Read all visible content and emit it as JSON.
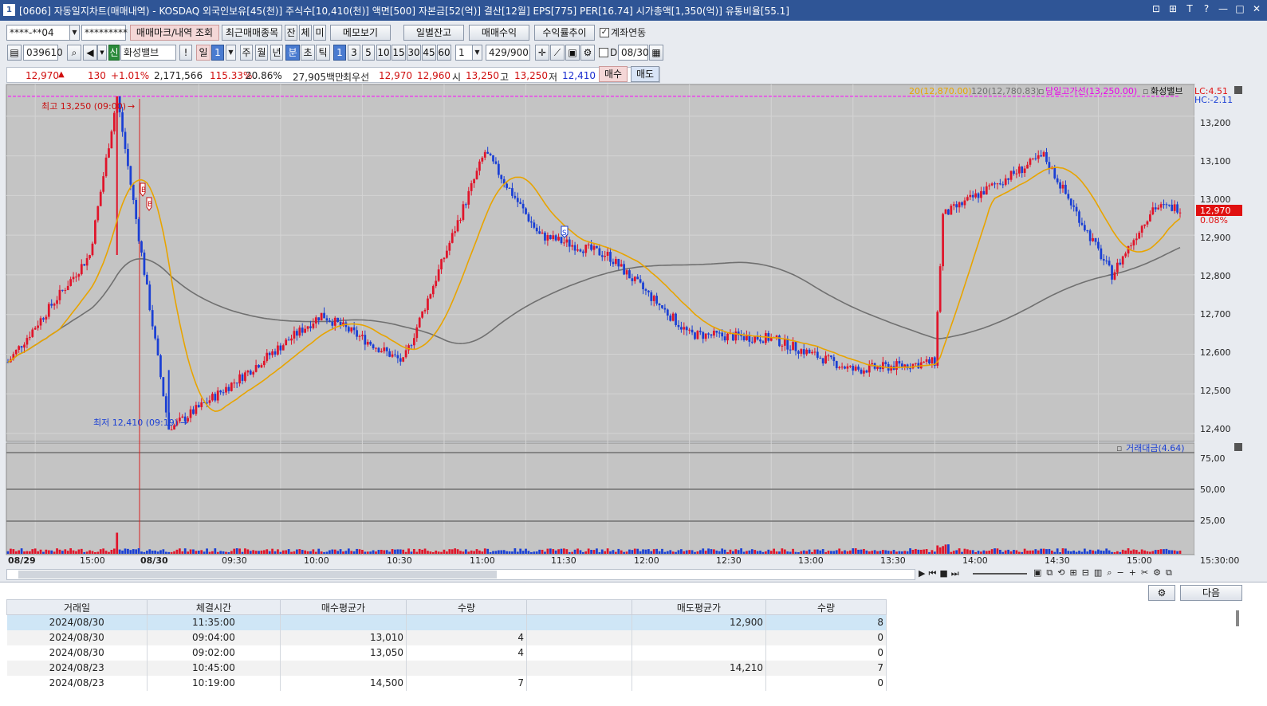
{
  "window": {
    "title": "[0606] 자동일지차트(매매내역) - KOSDAQ 외국인보유[45(천)] 주식수[10,410(천)] 액면[500] 자본금[52(억)] 결산[12월] EPS[775] PER[16.74] 시가총액[1,350(억)] 유통비율[55.1]",
    "icon": "1",
    "buttons": [
      "⊡",
      "⊞",
      "T",
      "?",
      "—",
      "□",
      "✕"
    ]
  },
  "toolbar1": {
    "account": "****-**04",
    "password": "*********",
    "trade_mark_btn": "매매마크/내역 조회",
    "recent_items_btn": "최근매매종목",
    "tab_jan": "잔",
    "tab_che": "체",
    "tab_mi": "미",
    "memo_btn": "메모보기",
    "daily_balance_btn": "일별잔고",
    "trade_profit_btn": "매매수익",
    "return_trend_btn": "수익률추이",
    "account_link_label": "계좌연동"
  },
  "toolbar2": {
    "code": "039610",
    "badge": "신",
    "stock_name": "화성밸브",
    "exclaim": "!",
    "period_day": "일",
    "period_num": "1",
    "periods": [
      "주",
      "월",
      "년",
      "분",
      "초",
      "틱"
    ],
    "active_period": "분",
    "intervals": [
      "1",
      "3",
      "5",
      "10",
      "15",
      "30",
      "45",
      "60"
    ],
    "active_interval": "1",
    "custom_interval": "1",
    "count": "429",
    "count_total": "/900",
    "d_label": "D",
    "date": "08/30"
  },
  "quote": {
    "price": "12,970",
    "arrow": "▲",
    "change": "130",
    "change_pct": "+1.01%",
    "volume": "2,171,566",
    "vol_ratio": "115.33%",
    "turnover": "20.86%",
    "amount": "27,905백만",
    "best_label": "최우선",
    "best_sell": "12,970",
    "best_buy": "12,960",
    "open_label": "시",
    "open": "13,250",
    "high_label": "고",
    "high": "13,250",
    "low_label": "저",
    "low": "12,410",
    "buy_btn": "매수",
    "sell_btn": "매도"
  },
  "chart": {
    "legend_ma20": "20(12,870.00)",
    "legend_ma120": "120(12,780.83)",
    "legend_high_line": "당일고가선(13,250.00)",
    "legend_stock": "화성밸브",
    "lc": "LC:4.51",
    "hc": "HC:-2.11",
    "price_ticks": [
      "13,200",
      "13,100",
      "13,000",
      "12,900",
      "12,800",
      "12,700",
      "12,600",
      "12,500",
      "12,400"
    ],
    "current_price": "12,970",
    "current_pct": "0.08%",
    "high_marker": "최고 13,250 (09:00)",
    "low_marker": "최저 12,410 (09:19)",
    "buy_mark": "B",
    "sell_mark": "S",
    "volume_legend": "거래대금(4.64)",
    "volume_ticks": [
      "75,00",
      "50,00",
      "25,00"
    ],
    "time_labels": [
      "08/29",
      "15:00",
      "08/30",
      "09:30",
      "10:00",
      "10:30",
      "11:00",
      "11:30",
      "12:00",
      "12:30",
      "13:00",
      "13:30",
      "14:00",
      "14:30",
      "15:00",
      "15:30:00"
    ],
    "colors": {
      "up": "#e0142a",
      "down": "#1a3fd4",
      "ma20": "#e8a400",
      "ma120": "#707070",
      "highline": "#ff00ff",
      "bg": "#c4c4c4"
    }
  },
  "chart_data": {
    "type": "candlestick",
    "title": "화성밸브 1분봉",
    "ylim": [
      12380,
      13280
    ],
    "x_range": [
      "08/29 14:50",
      "08/30 15:30"
    ],
    "key_points": [
      {
        "time": "08/29 14:50",
        "price": 12580
      },
      {
        "time": "08/29 15:20",
        "price": 12850
      },
      {
        "time": "08/30 09:00",
        "price": 13250
      },
      {
        "time": "08/30 09:19",
        "price": 12410
      },
      {
        "time": "08/30 09:45",
        "price": 12540
      },
      {
        "time": "08/30 10:15",
        "price": 12700
      },
      {
        "time": "08/30 10:45",
        "price": 12580
      },
      {
        "time": "08/30 11:15",
        "price": 13110
      },
      {
        "time": "08/30 11:35",
        "price": 12900
      },
      {
        "time": "08/30 12:00",
        "price": 12850
      },
      {
        "time": "08/30 12:30",
        "price": 12650
      },
      {
        "time": "08/30 13:00",
        "price": 12640
      },
      {
        "time": "08/30 13:30",
        "price": 12560
      },
      {
        "time": "08/30 14:00",
        "price": 12580
      },
      {
        "time": "08/30 14:03",
        "price": 12950
      },
      {
        "time": "08/30 14:40",
        "price": 13100
      },
      {
        "time": "08/30 15:05",
        "price": 12800
      },
      {
        "time": "08/30 15:20",
        "price": 12970
      }
    ],
    "ma20_last": 12870,
    "ma120_last": 12780.83,
    "day_high": 13250,
    "day_low": 12410
  },
  "trades": {
    "headers": [
      "거래일",
      "체결시간",
      "매수평균가",
      "수량",
      "",
      "매도평균가",
      "수량"
    ],
    "rows": [
      [
        "2024/08/30",
        "11:35:00",
        "",
        "",
        "",
        "12,900",
        "8"
      ],
      [
        "2024/08/30",
        "09:04:00",
        "13,010",
        "4",
        "",
        "",
        "0"
      ],
      [
        "2024/08/30",
        "09:02:00",
        "13,050",
        "4",
        "",
        "",
        "0"
      ],
      [
        "2024/08/23",
        "10:45:00",
        "",
        "",
        "",
        "14,210",
        "7"
      ],
      [
        "2024/08/23",
        "10:19:00",
        "14,500",
        "7",
        "",
        "",
        "0"
      ]
    ],
    "next_btn": "다음"
  }
}
